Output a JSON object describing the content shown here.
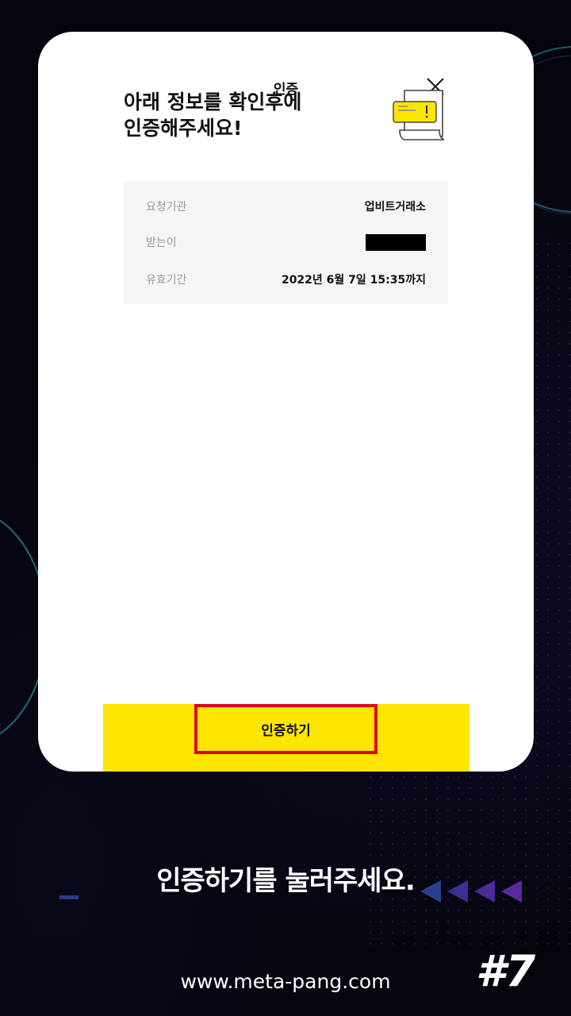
{
  "modal": {
    "title": "인증",
    "headline": "아래 정보를 확인후에\n인증해주세요!",
    "rows": [
      {
        "label": "요청기관",
        "value": "업비트거래소"
      },
      {
        "label": "받는이",
        "value": ""
      },
      {
        "label": "유효기간",
        "value": "2022년 6월 7일 15:35까지"
      }
    ],
    "confirm_label": "인증하기"
  },
  "caption": "인증하기를 눌러주세요.",
  "footer": {
    "url": "www.meta-pang.com",
    "step": "#7"
  },
  "icons": {
    "close": "close-icon",
    "document": "document-alert-icon",
    "arrows": "arrow-left-icons"
  },
  "colors": {
    "accent_yellow": "#ffe600",
    "highlight_red": "#e0001a",
    "background": "#04040c"
  }
}
